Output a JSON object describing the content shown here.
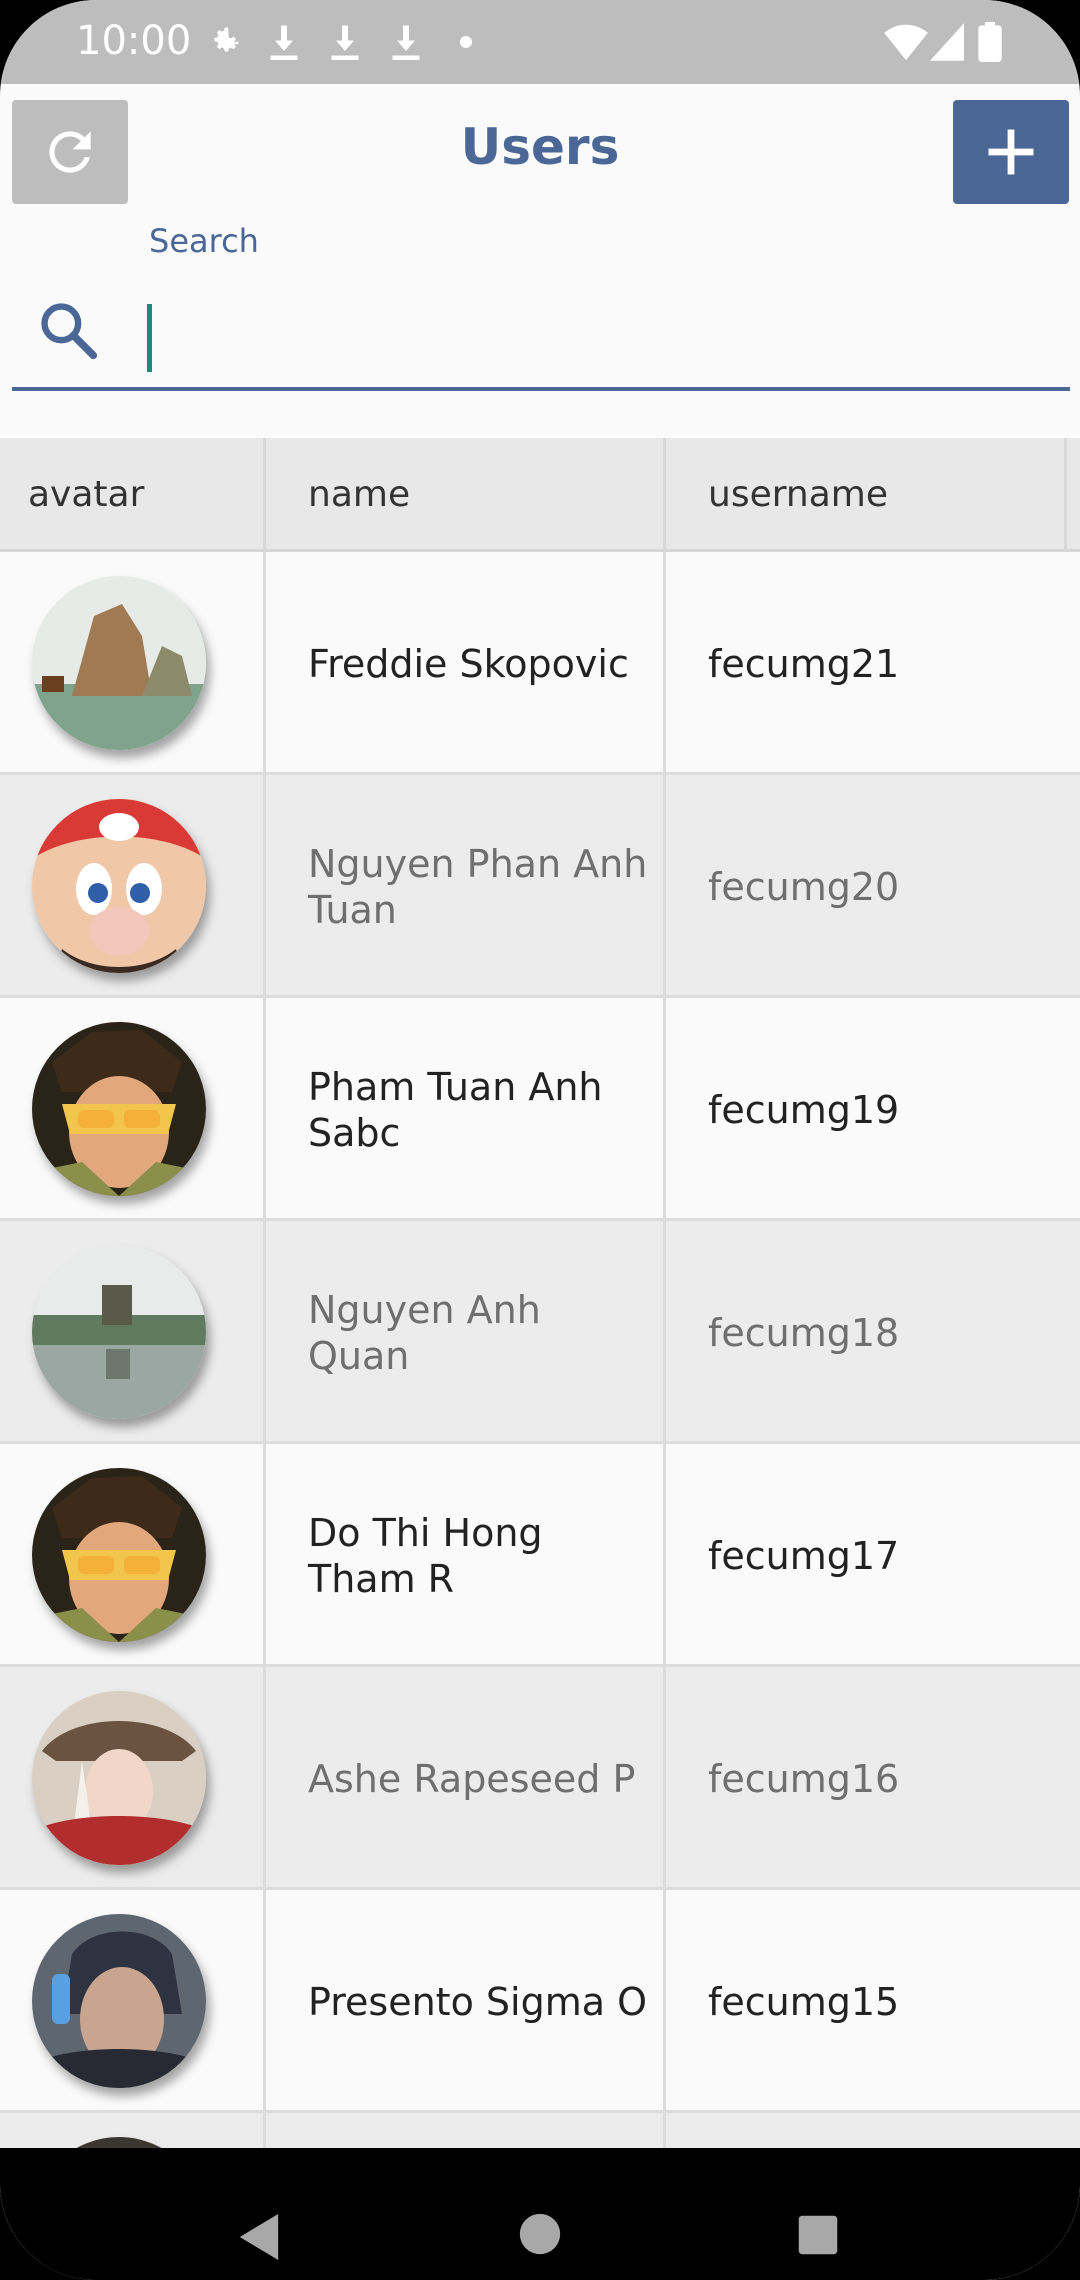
{
  "status_bar": {
    "time": "10:00",
    "icons": [
      "gear-icon",
      "download-icon",
      "download-icon",
      "download-icon",
      "dot-icon"
    ],
    "right_icons": [
      "wifi-icon",
      "signal-icon",
      "battery-icon"
    ]
  },
  "app_bar": {
    "title": "Users",
    "refresh_icon": "refresh-icon",
    "add_icon": "plus-icon"
  },
  "search": {
    "label": "Search",
    "value": "",
    "icon": "search-icon"
  },
  "table": {
    "columns": [
      "avatar",
      "name",
      "username"
    ],
    "rows": [
      {
        "name": "Freddie Skopovic",
        "username": "fecumg21",
        "avatar": "landscape-rock"
      },
      {
        "name": "Nguyen Phan Anh Tuan",
        "username": "fecumg20",
        "avatar": "mario"
      },
      {
        "name": "Pham Tuan Anh Sabc",
        "username": "fecumg19",
        "avatar": "tracer"
      },
      {
        "name": "Nguyen Anh Quan",
        "username": "fecumg18",
        "avatar": "lake-temple"
      },
      {
        "name": "Do Thi Hong Tham R",
        "username": "fecumg17",
        "avatar": "tracer"
      },
      {
        "name": "Ashe Rapeseed P",
        "username": "fecumg16",
        "avatar": "ashe"
      },
      {
        "name": "Presento Sigma O",
        "username": "fecumg15",
        "avatar": "sigma"
      }
    ]
  },
  "colors": {
    "accent": "#4a6796",
    "caret": "#1e8a7e",
    "status_bar": "#bdbdbd"
  },
  "nav_bar": {
    "icons": [
      "back-icon",
      "home-icon",
      "recents-icon"
    ]
  }
}
